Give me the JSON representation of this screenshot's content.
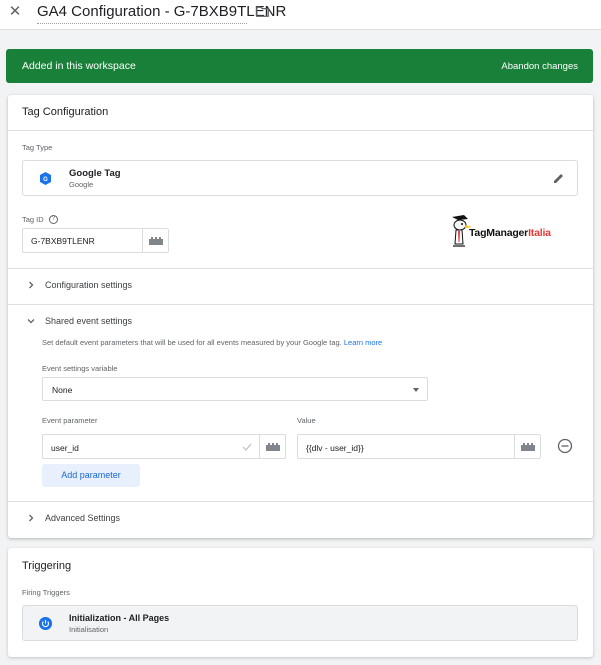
{
  "header": {
    "title": "GA4 Configuration - G-7BXB9TLENR"
  },
  "banner": {
    "text": "Added in this workspace",
    "action": "Abandon changes"
  },
  "tag_config": {
    "title": "Tag Configuration",
    "tag_type_label": "Tag Type",
    "tag_type_name": "Google Tag",
    "tag_type_sub": "Google",
    "tag_id_label": "Tag ID",
    "tag_id_value": "G-7BXB9TLENR",
    "logo_part1": "TagManager",
    "logo_part2": "Italia",
    "configuration_settings": "Configuration settings",
    "shared_event_settings": "Shared event settings",
    "shared_desc": "Set default event parameters that will be used for all events measured by your Google tag.",
    "learn_more": "Learn more",
    "event_settings_variable_label": "Event settings variable",
    "event_settings_variable_value": "None",
    "event_parameter_label": "Event parameter",
    "value_label": "Value",
    "event_parameter_value": "user_id",
    "value_value": "{{dlv - user_id}}",
    "add_parameter": "Add parameter",
    "advanced_settings": "Advanced Settings"
  },
  "triggering": {
    "title": "Triggering",
    "firing_triggers_label": "Firing Triggers",
    "trigger_name": "Initialization - All Pages",
    "trigger_sub": "Initialisation"
  },
  "colors": {
    "banner_green": "#188038",
    "link_blue": "#1a73e8",
    "logo_red": "#e53935"
  },
  "icons": [
    "close-icon",
    "folder-icon",
    "google-tag-icon",
    "pencil-icon",
    "help-icon",
    "variable-icon",
    "chevron-right-icon",
    "chevron-down-icon",
    "caret-down-icon",
    "check-icon",
    "remove-circle-icon",
    "power-icon"
  ]
}
